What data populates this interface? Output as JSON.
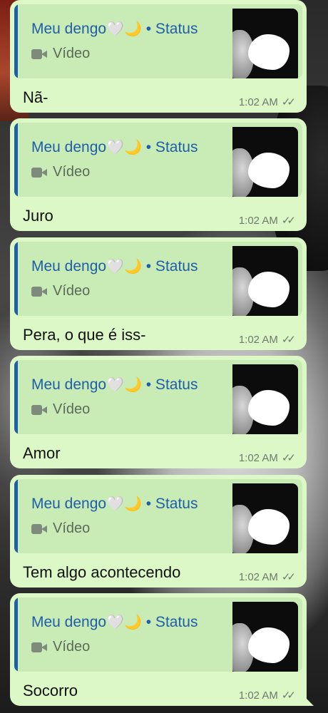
{
  "messages": [
    {
      "reply_name": "Meu dengo",
      "reply_emoji": "🤍🌙",
      "reply_suffix": "• Status",
      "reply_type": "Vídeo",
      "text": "Nã-",
      "time": "1:02 AM"
    },
    {
      "reply_name": "Meu dengo",
      "reply_emoji": "🤍🌙",
      "reply_suffix": "• Status",
      "reply_type": "Vídeo",
      "text": "Juro",
      "time": "1:02 AM"
    },
    {
      "reply_name": "Meu dengo",
      "reply_emoji": "🤍🌙",
      "reply_suffix": "• Status",
      "reply_type": "Vídeo",
      "text": "Pera, o que é iss-",
      "time": "1:02 AM"
    },
    {
      "reply_name": "Meu dengo",
      "reply_emoji": "🤍🌙",
      "reply_suffix": "• Status",
      "reply_type": "Vídeo",
      "text": "Amor",
      "time": "1:02 AM"
    },
    {
      "reply_name": "Meu dengo",
      "reply_emoji": "🤍🌙",
      "reply_suffix": "• Status",
      "reply_type": "Vídeo",
      "text": "Tem algo acontecendo",
      "time": "1:02 AM"
    },
    {
      "reply_name": "Meu dengo",
      "reply_emoji": "🤍🌙",
      "reply_suffix": "• Status",
      "reply_type": "Vídeo",
      "text": "Socorro",
      "time": "1:02 AM"
    }
  ],
  "ticks": "✓✓",
  "icons": {
    "video": "video-camera-icon",
    "status": "double-check-icon"
  },
  "colors": {
    "bubble": "#dcf8c6",
    "quote": "#c9ebb5",
    "accent": "#1f5ea8",
    "text": "#111111",
    "meta": "#6f7a6e"
  }
}
